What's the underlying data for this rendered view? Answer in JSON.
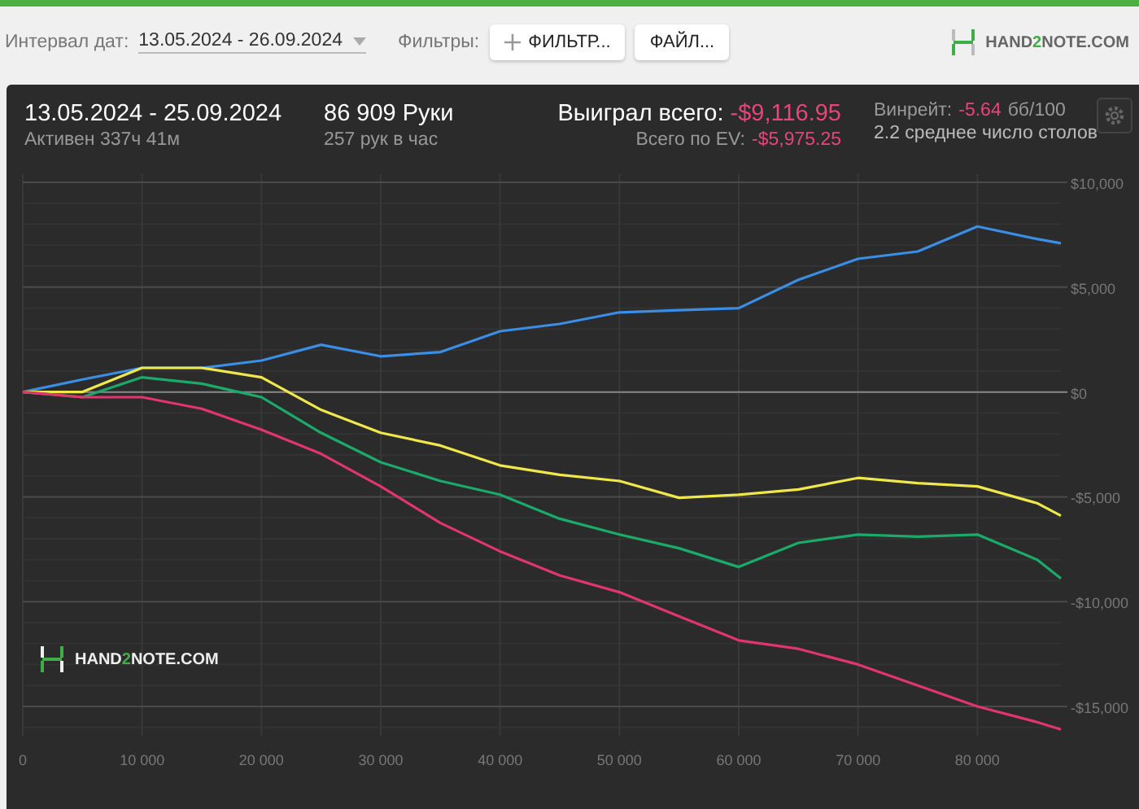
{
  "toolbar": {
    "date_label": "Интервал дат:",
    "date_value": "13.05.2024 - 26.09.2024",
    "filters_label": "Фильтры:",
    "buttons": [
      {
        "kind": "add",
        "label": "ФИЛЬТР..."
      },
      {
        "kind": "plain",
        "label": "ФАЙЛ..."
      }
    ],
    "logo_parts": [
      "HAND",
      "2",
      "NOTE.COM"
    ]
  },
  "summary": {
    "period": "13.05.2024 - 25.09.2024",
    "active": "Активен 337ч 41м",
    "hands": "86 909 Руки",
    "hands_rate": "257 рук в час",
    "won_label": "Выиграл всего:",
    "won_value": "-$9,116.95",
    "ev_label": "Всего по EV:",
    "ev_value": "-$5,975.25",
    "winrate_label": "Винрейт:",
    "winrate_value": "-5.64",
    "winrate_unit": "бб/100",
    "tables": "2.2 среднее число столов"
  },
  "chart_logo_parts": [
    "HAND",
    "2",
    "NOTE.COM"
  ],
  "chart_data": {
    "type": "line",
    "x": [
      0,
      5000,
      10000,
      15000,
      20000,
      25000,
      30000,
      35000,
      40000,
      45000,
      50000,
      55000,
      60000,
      65000,
      70000,
      75000,
      80000,
      85000,
      87000
    ],
    "series": [
      {
        "color": "#3a8ee6",
        "values": [
          0,
          600,
          1150,
          1150,
          1500,
          2250,
          1700,
          1900,
          2900,
          3250,
          3800,
          3900,
          4000,
          5350,
          6350,
          6700,
          7900,
          7300,
          7100
        ]
      },
      {
        "color": "#f0e84a",
        "values": [
          0,
          0,
          1150,
          1150,
          700,
          -850,
          -1950,
          -2550,
          -3500,
          -3950,
          -4250,
          -5050,
          -4900,
          -4650,
          -4100,
          -4350,
          -4500,
          -5300,
          -5900
        ]
      },
      {
        "color": "#1aab6a",
        "values": [
          0,
          -250,
          700,
          400,
          -250,
          -1950,
          -3350,
          -4250,
          -4900,
          -6050,
          -6800,
          -7450,
          -8350,
          -7200,
          -6800,
          -6900,
          -6800,
          -8000,
          -8900
        ]
      },
      {
        "color": "#e0356e",
        "values": [
          0,
          -250,
          -250,
          -800,
          -1800,
          -2950,
          -4500,
          -6250,
          -7600,
          -8750,
          -9550,
          -10700,
          -11850,
          -12250,
          -13000,
          -14000,
          -15000,
          -15750,
          -16100
        ]
      }
    ],
    "grid": true,
    "xlim": [
      0,
      87000
    ],
    "ylim": [
      -16500,
      10500
    ],
    "xticks": [
      {
        "value": 0,
        "label": "0"
      },
      {
        "value": 10000,
        "label": "10 000"
      },
      {
        "value": 20000,
        "label": "20 000"
      },
      {
        "value": 30000,
        "label": "30 000"
      },
      {
        "value": 40000,
        "label": "40 000"
      },
      {
        "value": 50000,
        "label": "50 000"
      },
      {
        "value": 60000,
        "label": "60 000"
      },
      {
        "value": 70000,
        "label": "70 000"
      },
      {
        "value": 80000,
        "label": "80 000"
      }
    ],
    "yticks": [
      {
        "value": 10000,
        "label": "$10,000"
      },
      {
        "value": 5000,
        "label": "$5,000"
      },
      {
        "value": 0,
        "label": "$0"
      },
      {
        "value": -5000,
        "label": "-$5,000"
      },
      {
        "value": -10000,
        "label": "-$10,000"
      },
      {
        "value": -15000,
        "label": "-$15,000"
      }
    ]
  }
}
